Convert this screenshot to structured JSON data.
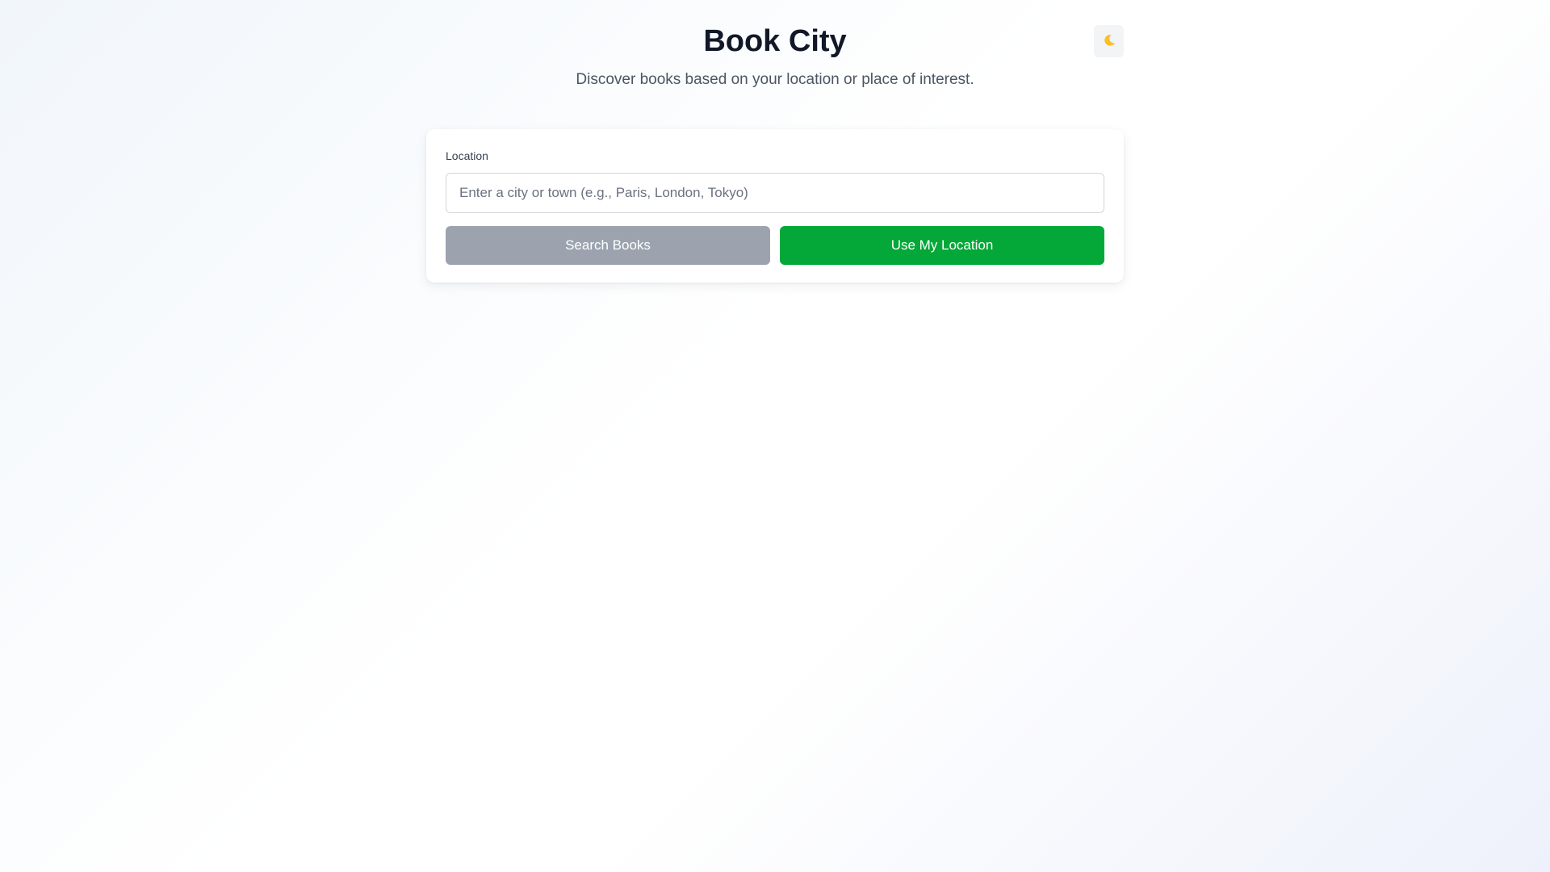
{
  "header": {
    "title": "Book City",
    "subtitle": "Discover books based on your location or place of interest.",
    "theme_toggle_icon": "🌙"
  },
  "search": {
    "label": "Location",
    "value": "",
    "placeholder": "Enter a city or town (e.g., Paris, London, Tokyo)"
  },
  "actions": {
    "search_label": "Search Books",
    "location_label": "Use My Location"
  },
  "colors": {
    "search_button": "#9ca3af",
    "location_button": "#03a838",
    "moon_icon": "#fbbf24"
  },
  "icons": {
    "theme_toggle": "moon-icon"
  }
}
